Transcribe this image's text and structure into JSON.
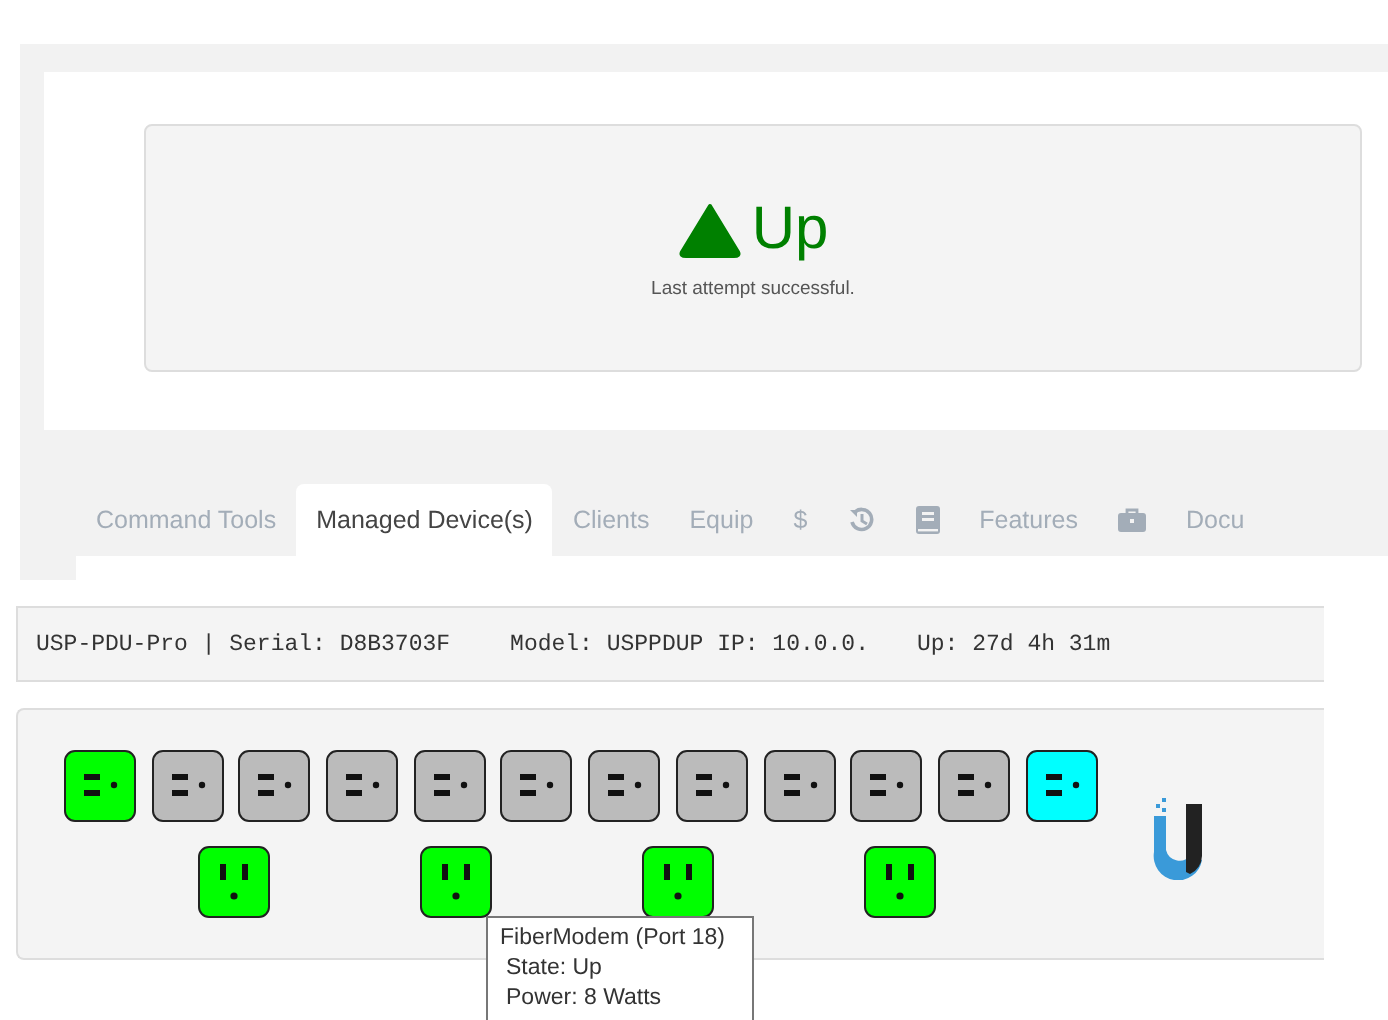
{
  "status": {
    "up": true,
    "label": "Up",
    "message": "Last attempt successful."
  },
  "tabs": [
    {
      "kind": "text",
      "label": "Command Tools",
      "selected": false
    },
    {
      "kind": "text",
      "label": "Managed Device(s)",
      "selected": true
    },
    {
      "kind": "text",
      "label": "Clients",
      "selected": false
    },
    {
      "kind": "text",
      "label": "Equip",
      "selected": false
    },
    {
      "kind": "text",
      "label": "$",
      "selected": false
    },
    {
      "kind": "history",
      "selected": false
    },
    {
      "kind": "book",
      "selected": false
    },
    {
      "kind": "text",
      "label": "Features",
      "selected": false
    },
    {
      "kind": "briefcase",
      "selected": false
    },
    {
      "kind": "text",
      "label": "Docu",
      "selected": false
    }
  ],
  "device_info": [
    "USP-PDU-Pro | Serial: D8B3703F",
    "Model: USPPDUP IP: 10.0.0.",
    "Up: 27d 4h 31m"
  ],
  "outlets": [
    {
      "kind": "usb",
      "color": "#00ff00"
    },
    {
      "kind": "usb",
      "color": "#bbbbbb"
    },
    {
      "kind": "usb",
      "color": "#bbbbbb"
    },
    {
      "kind": "usb",
      "color": "#bbbbbb"
    },
    {
      "kind": "usb",
      "color": "#bbbbbb"
    },
    {
      "kind": "usb",
      "color": "#bbbbbb"
    },
    {
      "kind": "usb",
      "color": "#bbbbbb"
    },
    {
      "kind": "usb",
      "color": "#bbbbbb"
    },
    {
      "kind": "usb",
      "color": "#bbbbbb"
    },
    {
      "kind": "usb",
      "color": "#bbbbbb"
    },
    {
      "kind": "usb",
      "color": "#bbbbbb"
    },
    {
      "kind": "usb",
      "color": "#00ffff"
    },
    {
      "kind": "ac",
      "color": "#00ff00"
    },
    {
      "kind": "ac",
      "color": "#00ff00"
    },
    {
      "kind": "ac",
      "color": "#00ff00"
    },
    {
      "kind": "ac",
      "color": "#00ff00"
    }
  ],
  "tooltip": {
    "title": "FiberModem (Port 18)",
    "lines": [
      "State: Up",
      "Power: 8 Watts"
    ]
  }
}
